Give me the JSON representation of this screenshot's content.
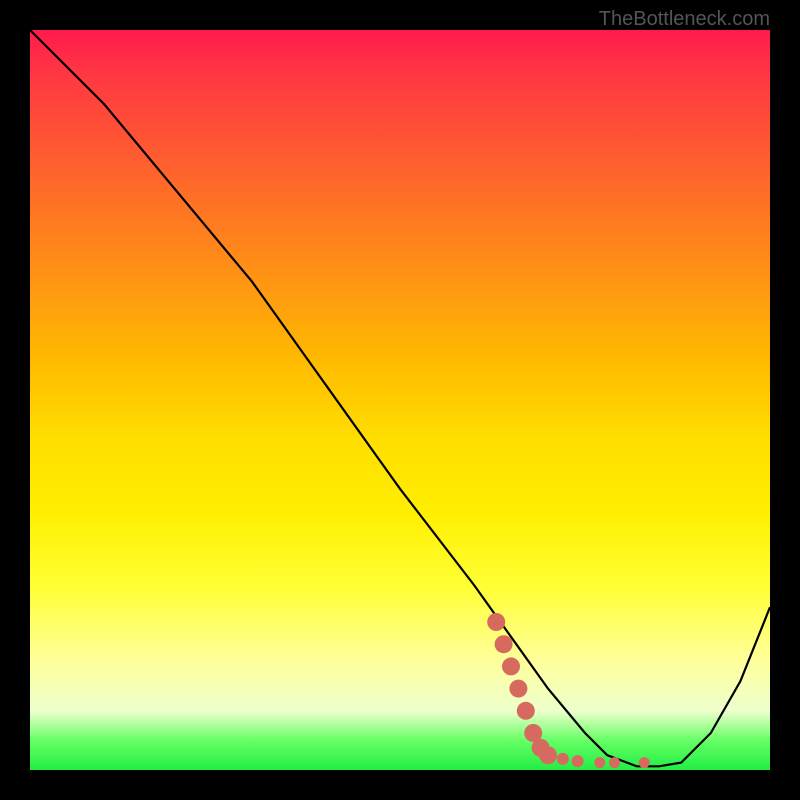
{
  "watermark": "TheBottleneck.com",
  "chart_data": {
    "type": "line",
    "title": "",
    "xlabel": "",
    "ylabel": "",
    "xlim": [
      0,
      100
    ],
    "ylim": [
      0,
      100
    ],
    "series": [
      {
        "name": "bottleneck-curve",
        "x": [
          0,
          10,
          20,
          30,
          40,
          50,
          60,
          65,
          70,
          75,
          78,
          82,
          85,
          88,
          92,
          96,
          100
        ],
        "y": [
          100,
          90,
          78,
          66,
          52,
          38,
          25,
          18,
          11,
          5,
          2,
          0.5,
          0.5,
          1,
          5,
          12,
          22
        ]
      }
    ],
    "markers": {
      "name": "highlight-dots",
      "color": "#d66a5f",
      "points": [
        {
          "x": 63,
          "y": 20
        },
        {
          "x": 64,
          "y": 17
        },
        {
          "x": 65,
          "y": 14
        },
        {
          "x": 66,
          "y": 11
        },
        {
          "x": 67,
          "y": 8
        },
        {
          "x": 68,
          "y": 5
        },
        {
          "x": 69,
          "y": 3
        },
        {
          "x": 70,
          "y": 2
        },
        {
          "x": 72,
          "y": 1.5
        },
        {
          "x": 74,
          "y": 1.2
        },
        {
          "x": 77,
          "y": 1
        },
        {
          "x": 79,
          "y": 1
        },
        {
          "x": 83,
          "y": 1
        }
      ]
    }
  }
}
